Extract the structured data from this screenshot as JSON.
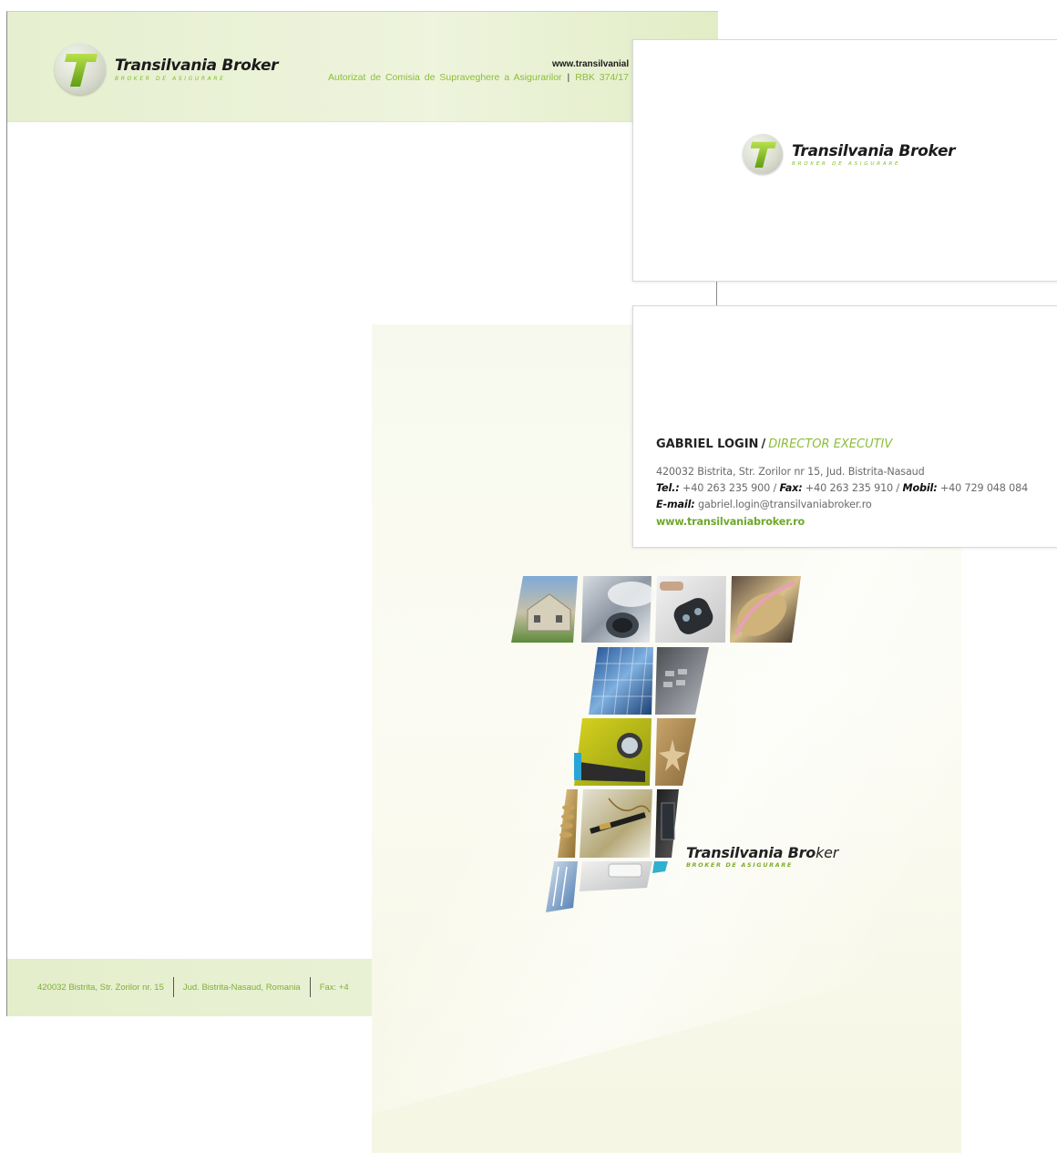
{
  "brand": {
    "name": "Transilvania Broker",
    "name_part1": "Transilvania Bro",
    "name_part2": "ker",
    "tagline": "BROKER DE ASIGURARE",
    "accent_color": "#8cbd3a",
    "mark_icon": "t-letter-logo-icon"
  },
  "letterhead": {
    "website": "www.transilvanial",
    "authorization": "Autorizat de Comisia de Supraveghere a Asigurarilor",
    "separator": "|",
    "rbk": "RBK 374/17",
    "footer": {
      "address": "420032 Bistrita, Str. Zorilor nr. 15",
      "county": "Jud. Bistrita-Nasaud, Romania",
      "fax": "Fax: +4"
    }
  },
  "business_card": {
    "name": "GABRIEL LOGIN",
    "slash": "/",
    "role": "DIRECTOR EXECUTIV",
    "address": "420032 Bistrita, Str. Zorilor nr 15, Jud. Bistrita-Nasaud",
    "tel_label": "Tel.:",
    "tel": " +40 263 235 900 / ",
    "fax_label": "Fax:",
    "fax": " +40 263 235 910 / ",
    "mobil_label": "Mobil:",
    "mobil": " +40 729 048 084",
    "email_label": "E-mail:",
    "email": " gabriel.login@transilvaniabroker.ro",
    "website": "www.transilvaniabroker.ro"
  },
  "folder": {
    "collage_tiles": [
      "house",
      "car-exhaust",
      "car-key",
      "shoe",
      "glass-building",
      "keyboard",
      "yellow-car",
      "starfish",
      "coins",
      "fountain-pen",
      "monitor",
      "calculator",
      "keyboard-key",
      "blue-column"
    ]
  }
}
